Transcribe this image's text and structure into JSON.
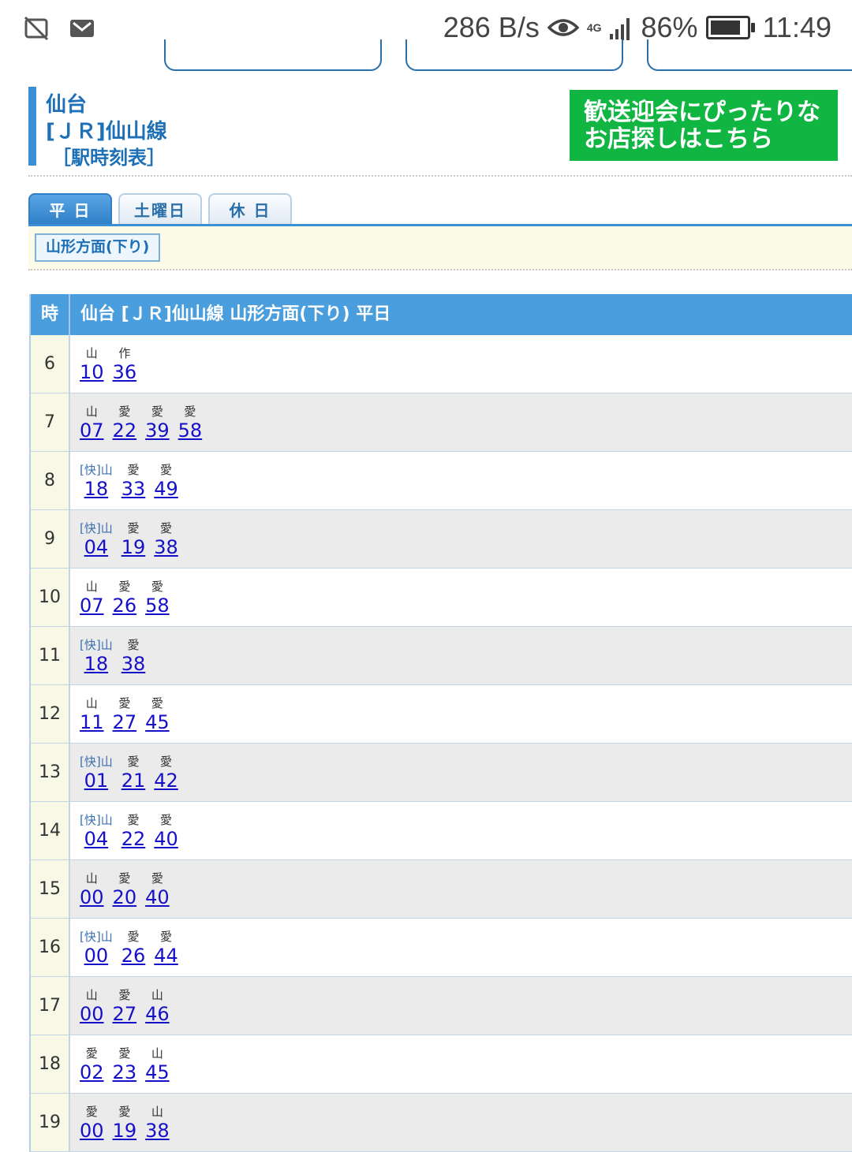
{
  "status_bar": {
    "speed": "286 B/s",
    "network": "4G",
    "battery": "86%",
    "battery_level": 0.86,
    "time": "11:49",
    "icons": [
      "no-disturb-icon",
      "mail-icon",
      "eye-icon",
      "signal-icon",
      "battery-icon"
    ]
  },
  "header": {
    "station": "仙台",
    "line": "[ＪＲ]仙山線",
    "kind": "［駅時刻表］",
    "ad_line1": "歓送迎会にぴったりな",
    "ad_line2": "お店探しはこちら"
  },
  "tabs": [
    "平 日",
    "土曜日",
    "休 日"
  ],
  "active_tab": 0,
  "direction_button": "山形方面(下り)",
  "table": {
    "hour_header": "時",
    "title": "仙台 [ＪＲ]仙山線 山形方面(下り) 平日",
    "rows": [
      {
        "hour": "6",
        "deps": [
          {
            "tag": "山",
            "min": "10"
          },
          {
            "tag": "作",
            "min": "36"
          }
        ]
      },
      {
        "hour": "7",
        "deps": [
          {
            "tag": "山",
            "min": "07"
          },
          {
            "tag": "愛",
            "min": "22"
          },
          {
            "tag": "愛",
            "min": "39"
          },
          {
            "tag": "愛",
            "min": "58"
          }
        ]
      },
      {
        "hour": "8",
        "deps": [
          {
            "tag": "[快]山",
            "min": "18"
          },
          {
            "tag": "愛",
            "min": "33"
          },
          {
            "tag": "愛",
            "min": "49"
          }
        ]
      },
      {
        "hour": "9",
        "deps": [
          {
            "tag": "[快]山",
            "min": "04"
          },
          {
            "tag": "愛",
            "min": "19"
          },
          {
            "tag": "愛",
            "min": "38"
          }
        ]
      },
      {
        "hour": "10",
        "deps": [
          {
            "tag": "山",
            "min": "07"
          },
          {
            "tag": "愛",
            "min": "26"
          },
          {
            "tag": "愛",
            "min": "58"
          }
        ]
      },
      {
        "hour": "11",
        "deps": [
          {
            "tag": "[快]山",
            "min": "18"
          },
          {
            "tag": "愛",
            "min": "38"
          }
        ]
      },
      {
        "hour": "12",
        "deps": [
          {
            "tag": "山",
            "min": "11"
          },
          {
            "tag": "愛",
            "min": "27"
          },
          {
            "tag": "愛",
            "min": "45"
          }
        ]
      },
      {
        "hour": "13",
        "deps": [
          {
            "tag": "[快]山",
            "min": "01"
          },
          {
            "tag": "愛",
            "min": "21"
          },
          {
            "tag": "愛",
            "min": "42"
          }
        ]
      },
      {
        "hour": "14",
        "deps": [
          {
            "tag": "[快]山",
            "min": "04"
          },
          {
            "tag": "愛",
            "min": "22"
          },
          {
            "tag": "愛",
            "min": "40"
          }
        ]
      },
      {
        "hour": "15",
        "deps": [
          {
            "tag": "山",
            "min": "00"
          },
          {
            "tag": "愛",
            "min": "20"
          },
          {
            "tag": "愛",
            "min": "40"
          }
        ]
      },
      {
        "hour": "16",
        "deps": [
          {
            "tag": "[快]山",
            "min": "00"
          },
          {
            "tag": "愛",
            "min": "26"
          },
          {
            "tag": "愛",
            "min": "44"
          }
        ]
      },
      {
        "hour": "17",
        "deps": [
          {
            "tag": "山",
            "min": "00"
          },
          {
            "tag": "愛",
            "min": "27"
          },
          {
            "tag": "山",
            "min": "46"
          }
        ]
      },
      {
        "hour": "18",
        "deps": [
          {
            "tag": "愛",
            "min": "02"
          },
          {
            "tag": "愛",
            "min": "23"
          },
          {
            "tag": "山",
            "min": "45"
          }
        ]
      },
      {
        "hour": "19",
        "deps": [
          {
            "tag": "愛",
            "min": "00"
          },
          {
            "tag": "愛",
            "min": "19"
          },
          {
            "tag": "山",
            "min": "38"
          }
        ]
      }
    ]
  },
  "colors": {
    "accent": "#3b8fd4",
    "table_header": "#4a9ede",
    "link": "#1510c8",
    "ad_bg": "#11b542"
  }
}
